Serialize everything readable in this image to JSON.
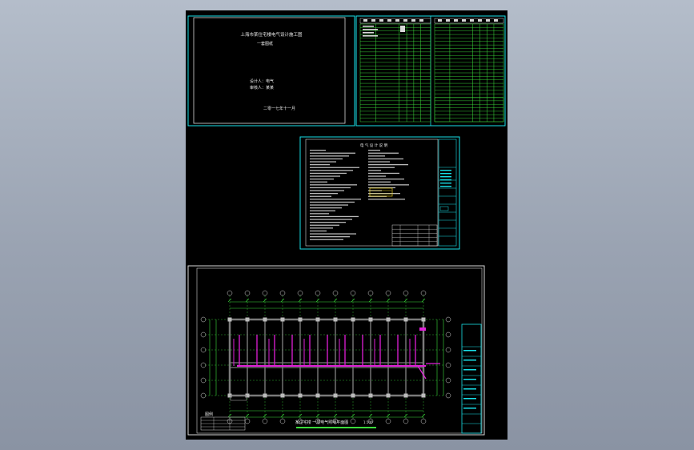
{
  "viewer": {
    "background_top": "#b4bdca",
    "background_bottom": "#8a93a3",
    "sheet_color": "#000000"
  },
  "cover": {
    "title": "上海市某住宅楼电气设计施工图",
    "subtitle": "一套图纸",
    "designer_line": "设计人：电气",
    "checker_line": "审核人：某某",
    "date_line": "二零一七年十一月"
  },
  "notes": {
    "heading": "电 气 设 计 说 明"
  },
  "plan": {
    "caption": "某住宅楼 一层电气照明平面图",
    "scale": "1:100",
    "legend_heading": "图例"
  },
  "colors": {
    "frame": "#18e0e8",
    "grid": "#3cdc3c",
    "wiring": "#e020d8",
    "walls": "#7a7a7a",
    "text": "#e8e8e8"
  }
}
